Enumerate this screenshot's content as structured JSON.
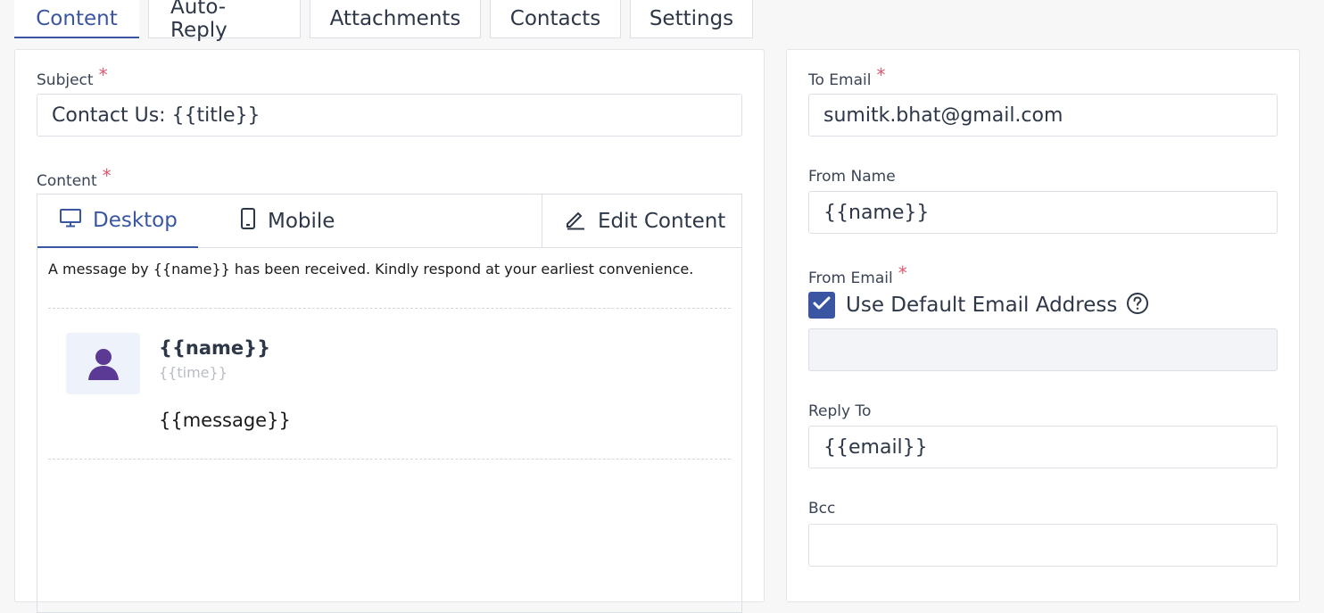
{
  "tabs": [
    {
      "label": "Content",
      "active": true
    },
    {
      "label": "Auto-Reply",
      "active": false
    },
    {
      "label": "Attachments",
      "active": false
    },
    {
      "label": "Contacts",
      "active": false
    },
    {
      "label": "Settings",
      "active": false
    }
  ],
  "content_panel": {
    "subject": {
      "label": "Subject",
      "required": "*",
      "value": "Contact Us: {{title}}"
    },
    "content": {
      "label": "Content",
      "required": "*"
    },
    "editor": {
      "view_desktop": "Desktop",
      "view_mobile": "Mobile",
      "edit_button": "Edit Content",
      "intro_text": "A message by {{name}} has been received. Kindly respond at your earliest convenience.",
      "message_name": "{{name}}",
      "message_time": "{{time}}",
      "message_body": "{{message}}"
    }
  },
  "settings_panel": {
    "to_email": {
      "label": "To Email",
      "required": "*",
      "value": "sumitk.bhat@gmail.com"
    },
    "from_name": {
      "label": "From Name",
      "value": "{{name}}"
    },
    "from_email": {
      "label": "From Email",
      "required": "*",
      "checkbox_label": "Use Default Email Address",
      "checked": true,
      "value": ""
    },
    "reply_to": {
      "label": "Reply To",
      "value": "{{email}}"
    },
    "bcc": {
      "label": "Bcc",
      "value": ""
    }
  },
  "colors": {
    "accent": "#3a56a3",
    "required": "#e5576b",
    "border": "#dcdfe6",
    "avatar_bg": "#edf2fb",
    "avatar_figure": "#5b3a96"
  },
  "icons": {
    "desktop": "monitor-icon",
    "mobile": "smartphone-icon",
    "edit": "pencil-icon",
    "help": "question-circle-icon",
    "check": "checkmark-icon",
    "avatar": "user-silhouette-icon"
  }
}
